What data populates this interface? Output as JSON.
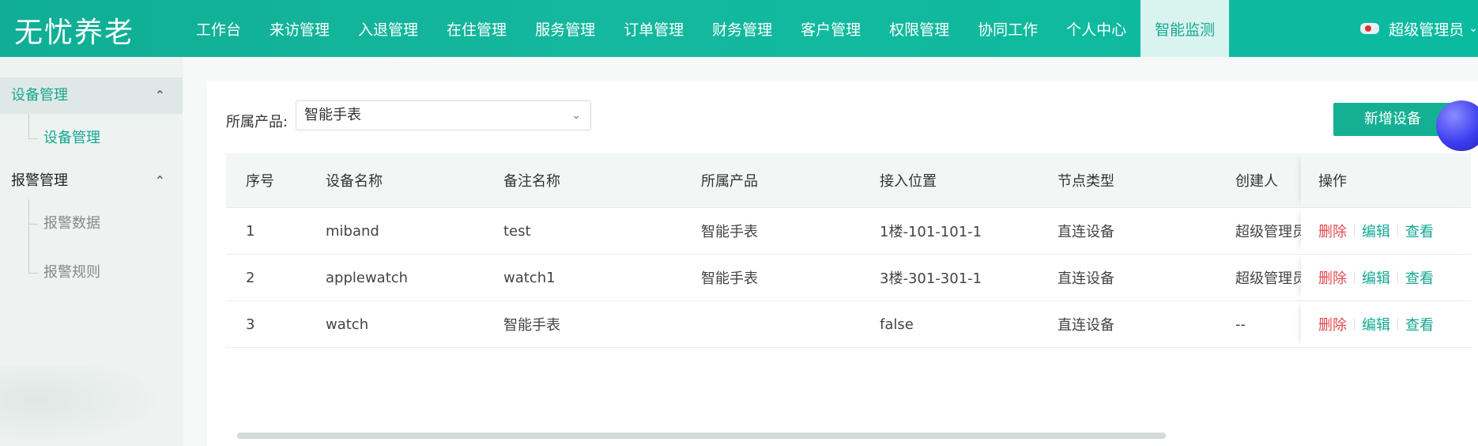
{
  "app": {
    "logo": "无忧养老"
  },
  "nav": {
    "items": [
      "工作台",
      "来访管理",
      "入退管理",
      "在住管理",
      "服务管理",
      "订单管理",
      "财务管理",
      "客户管理",
      "权限管理",
      "协同工作",
      "个人中心",
      "智能监测"
    ],
    "active_index": 11
  },
  "user": {
    "name": "超级管理员"
  },
  "sidebar": {
    "groups": [
      {
        "label": "设备管理",
        "expanded": true,
        "items": [
          "设备管理"
        ]
      },
      {
        "label": "报警管理",
        "expanded": true,
        "items": [
          "报警数据",
          "报警规则"
        ]
      }
    ]
  },
  "filter": {
    "label": "所属产品:",
    "selected": "智能手表"
  },
  "actions": {
    "add_device": "新增设备"
  },
  "table": {
    "headers": [
      "序号",
      "设备名称",
      "备注名称",
      "所属产品",
      "接入位置",
      "节点类型",
      "创建人",
      "操作"
    ],
    "rows": [
      [
        "1",
        "miband",
        "test",
        "智能手表",
        "1楼-101-101-1",
        "直连设备",
        "超级管理员"
      ],
      [
        "2",
        "applewatch",
        "watch1",
        "智能手表",
        "3楼-301-301-1",
        "直连设备",
        "超级管理员"
      ],
      [
        "3",
        "watch",
        "智能手表",
        "",
        "false",
        "直连设备",
        "--"
      ]
    ],
    "ops": {
      "delete": "删除",
      "edit": "编辑",
      "view": "查看"
    }
  },
  "colors": {
    "brand": "#14b89e",
    "danger": "#e5484d"
  }
}
